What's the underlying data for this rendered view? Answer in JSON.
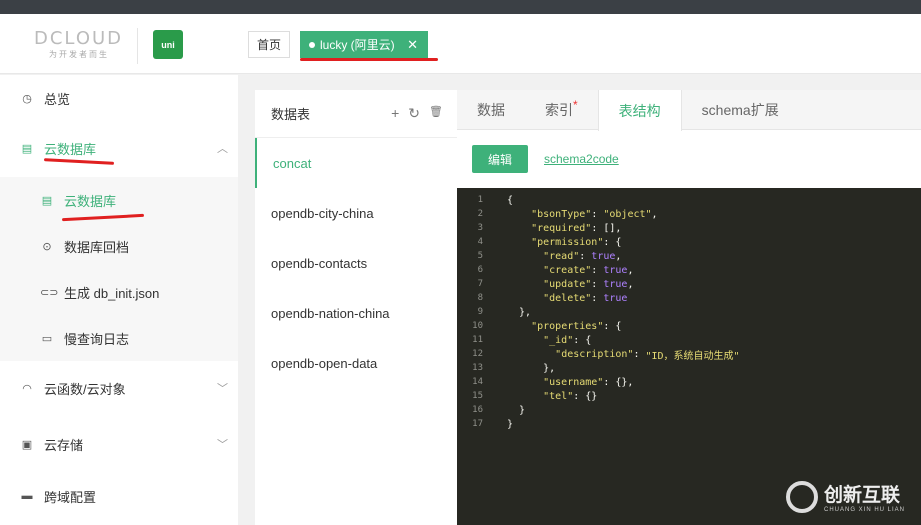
{
  "header": {
    "logo_text": "DCLOUD",
    "logo_sub": "为开发者而生",
    "uni_label": "uni",
    "home_tab": "首页",
    "active_tab": "lucky (阿里云)",
    "close": "✕"
  },
  "sidebar": {
    "items": [
      {
        "label": "总览",
        "icon": "◷"
      },
      {
        "label": "云数据库",
        "icon": "▤",
        "chev": "︿"
      },
      {
        "label": "云数据库",
        "icon": "▤"
      },
      {
        "label": "数据库回档",
        "icon": "⊙"
      },
      {
        "label": "生成 db_init.json",
        "icon": "⊂⊃"
      },
      {
        "label": "慢查询日志",
        "icon": "▭"
      },
      {
        "label": "云函数/云对象",
        "icon": "◠",
        "chev": "﹀"
      },
      {
        "label": "云存储",
        "icon": "▣",
        "chev": "﹀"
      },
      {
        "label": "跨域配置",
        "icon": "▬"
      }
    ]
  },
  "tables": {
    "title": "数据表",
    "add": "+",
    "refresh": "↻",
    "delete": "🗑",
    "items": [
      "concat",
      "opendb-city-china",
      "opendb-contacts",
      "opendb-nation-china",
      "opendb-open-data"
    ]
  },
  "tabs": [
    {
      "label": "数据"
    },
    {
      "label": "索引",
      "star": "*"
    },
    {
      "label": "表结构"
    },
    {
      "label": "schema扩展"
    }
  ],
  "toolbar": {
    "edit": "编辑",
    "schema2code": "schema2code"
  },
  "code": [
    [
      [
        "p",
        "{"
      ]
    ],
    [
      [
        "p",
        "    "
      ],
      [
        "k",
        "\"bsonType\""
      ],
      [
        "p",
        ": "
      ],
      [
        "k",
        "\"object\""
      ],
      [
        "p",
        ","
      ]
    ],
    [
      [
        "p",
        "    "
      ],
      [
        "k",
        "\"required\""
      ],
      [
        "p",
        ": [],"
      ]
    ],
    [
      [
        "p",
        "    "
      ],
      [
        "k",
        "\"permission\""
      ],
      [
        "p",
        ": {"
      ]
    ],
    [
      [
        "p",
        "      "
      ],
      [
        "k",
        "\"read\""
      ],
      [
        "p",
        ": "
      ],
      [
        "t",
        "true"
      ],
      [
        "p",
        ","
      ]
    ],
    [
      [
        "p",
        "      "
      ],
      [
        "k",
        "\"create\""
      ],
      [
        "p",
        ": "
      ],
      [
        "t",
        "true"
      ],
      [
        "p",
        ","
      ]
    ],
    [
      [
        "p",
        "      "
      ],
      [
        "k",
        "\"update\""
      ],
      [
        "p",
        ": "
      ],
      [
        "t",
        "true"
      ],
      [
        "p",
        ","
      ]
    ],
    [
      [
        "p",
        "      "
      ],
      [
        "k",
        "\"delete\""
      ],
      [
        "p",
        ": "
      ],
      [
        "t",
        "true"
      ]
    ],
    [
      [
        "p",
        "  },"
      ]
    ],
    [
      [
        "p",
        "    "
      ],
      [
        "k",
        "\"properties\""
      ],
      [
        "p",
        ": {"
      ]
    ],
    [
      [
        "p",
        "      "
      ],
      [
        "k",
        "\"_id\""
      ],
      [
        "p",
        ": {"
      ]
    ],
    [
      [
        "p",
        "        "
      ],
      [
        "k",
        "\"description\""
      ],
      [
        "p",
        ": "
      ],
      [
        "k",
        "\"ID，系统自动生成\""
      ]
    ],
    [
      [
        "p",
        "      },"
      ]
    ],
    [
      [
        "p",
        "      "
      ],
      [
        "k",
        "\"username\""
      ],
      [
        "p",
        ": {},"
      ]
    ],
    [
      [
        "p",
        "      "
      ],
      [
        "k",
        "\"tel\""
      ],
      [
        "p",
        ": {}"
      ]
    ],
    [
      [
        "p",
        "  }"
      ]
    ],
    [
      [
        "p",
        "}"
      ]
    ]
  ],
  "watermark": {
    "brand": "创新互联",
    "sub": "CHUANG XIN HU LIAN"
  }
}
